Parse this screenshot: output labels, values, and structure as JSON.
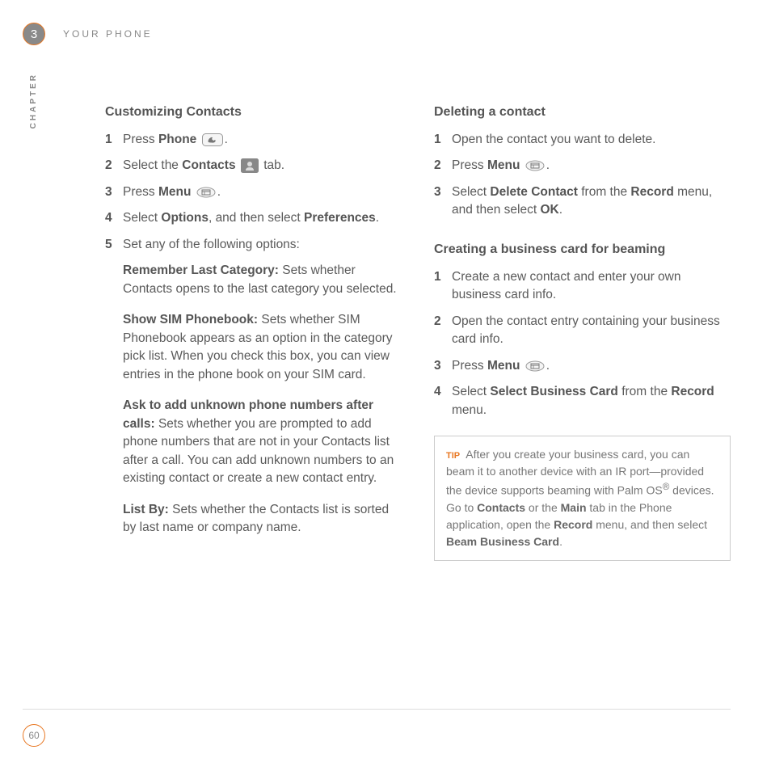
{
  "header": {
    "chapter_number": "3",
    "title": "YOUR PHONE",
    "vertical_label": "CHAPTER"
  },
  "left": {
    "heading": "Customizing Contacts",
    "s1_prefix": "Press ",
    "s1_bold": "Phone",
    "s1_suffix": " ",
    "s1_period": ".",
    "s2_prefix": "Select the ",
    "s2_bold": "Contacts",
    "s2_suffix": " tab.",
    "s3_prefix": "Press ",
    "s3_bold": "Menu",
    "s3_suffix": " ",
    "s3_period": ".",
    "s4_prefix": "Select ",
    "s4_bold1": "Options",
    "s4_mid": ", and then select ",
    "s4_bold2": "Preferences",
    "s4_suffix": ".",
    "s5_text": "Set any of the following options:",
    "opt1_label": "Remember Last Category:",
    "opt1_text": " Sets whether Contacts opens to the last category you selected.",
    "opt2_label": "Show SIM Phonebook:",
    "opt2_text": " Sets whether SIM Phonebook appears as an option in the category pick list. When you check this box, you can view entries in the phone book on your SIM card.",
    "opt3_label": "Ask to add unknown phone numbers after calls:",
    "opt3_text": " Sets whether you are prompted to add phone numbers that are not in your Contacts list after a call. You can add unknown numbers to an existing contact or create a new contact entry.",
    "opt4_label": "List By:",
    "opt4_text": " Sets whether the Contacts list is sorted by last name or company name."
  },
  "right": {
    "heading1": "Deleting a contact",
    "d1_text": "Open the contact you want to delete.",
    "d2_prefix": "Press ",
    "d2_bold": "Menu",
    "d2_suffix": " ",
    "d2_period": ".",
    "d3_prefix": "Select ",
    "d3_bold1": "Delete Contact",
    "d3_mid": " from the ",
    "d3_bold2": "Record",
    "d3_mid2": " menu, and then select ",
    "d3_bold3": "OK",
    "d3_suffix": ".",
    "heading2": "Creating a business card for beaming",
    "b1_text": "Create a new contact and enter your own business card info.",
    "b2_text": "Open the contact entry containing your business card info.",
    "b3_prefix": "Press ",
    "b3_bold": "Menu",
    "b3_suffix": " ",
    "b3_period": ".",
    "b4_prefix": "Select ",
    "b4_bold1": "Select Business Card",
    "b4_mid": " from the ",
    "b4_bold2": "Record",
    "b4_suffix": " menu."
  },
  "tip": {
    "label": "TIP",
    "t1": "After you create your business card, you can beam it to another device with an IR port—provided the device supports beaming with Palm OS",
    "reg": "®",
    "t2": " devices. Go to ",
    "b1": "Contacts",
    "t3": " or the ",
    "b2": "Main",
    "t4": " tab in the Phone application, open the ",
    "b3": "Record",
    "t5": " menu, and then select ",
    "b4": "Beam Business Card",
    "t6": "."
  },
  "footer": {
    "page": "60"
  },
  "nums": {
    "n1": "1",
    "n2": "2",
    "n3": "3",
    "n4": "4",
    "n5": "5"
  }
}
